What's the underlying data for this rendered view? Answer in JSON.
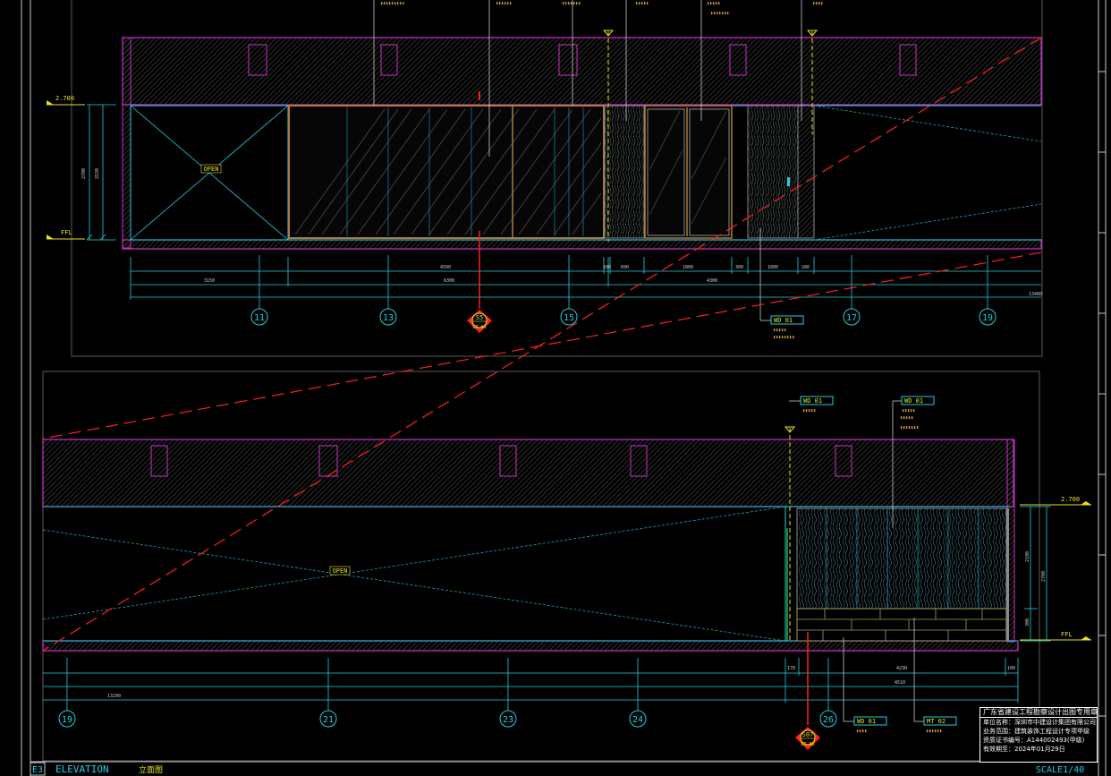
{
  "sheet": {
    "code": "E3",
    "title": "ELEVATION",
    "title_cn": "立面图",
    "scale": "SCALE1/40"
  },
  "upper_elevation": {
    "level_top": "2.700",
    "level_floor": "FFL",
    "open_label": "OPEN",
    "grid_marks": [
      "11",
      "13",
      "15",
      "17",
      "19"
    ],
    "section_mark": {
      "id": "S5",
      "ref": "DT-06"
    },
    "tag": "WD 01",
    "dims_row1": [
      "4500",
      "180",
      "690",
      "1800",
      "300",
      "1800",
      "280"
    ],
    "dims_row2": [
      "3150",
      "6300",
      "4300"
    ],
    "overall": "13480",
    "height_dims": [
      "2700",
      "2520"
    ]
  },
  "lower_elevation": {
    "level_top": "2.700",
    "level_floor": "FFL",
    "open_label": "OPEN",
    "grid_marks": [
      "19",
      "21",
      "23",
      "24",
      "26"
    ],
    "section_mark": {
      "id": "S07",
      "ref": "DT-06"
    },
    "tags_top": [
      "WD 01",
      "WD 01"
    ],
    "tags_bottom": [
      "WD 01",
      "MT 02"
    ],
    "dims_row1": [
      "170",
      "4230",
      "100"
    ],
    "dims_row2": [
      "13290",
      "4510"
    ],
    "height_dims": [
      "2100",
      "2700",
      "300"
    ]
  },
  "stamp": {
    "header": "广东省建设工程勘察设计出图专用章",
    "lines": [
      "单位名称：深圳市中建设计集团有限公司",
      "业务范围：建筑装饰工程设计专项甲级",
      "资质证书编号：A144002493(甲级)",
      "有效期至：2024年01月29日"
    ]
  }
}
